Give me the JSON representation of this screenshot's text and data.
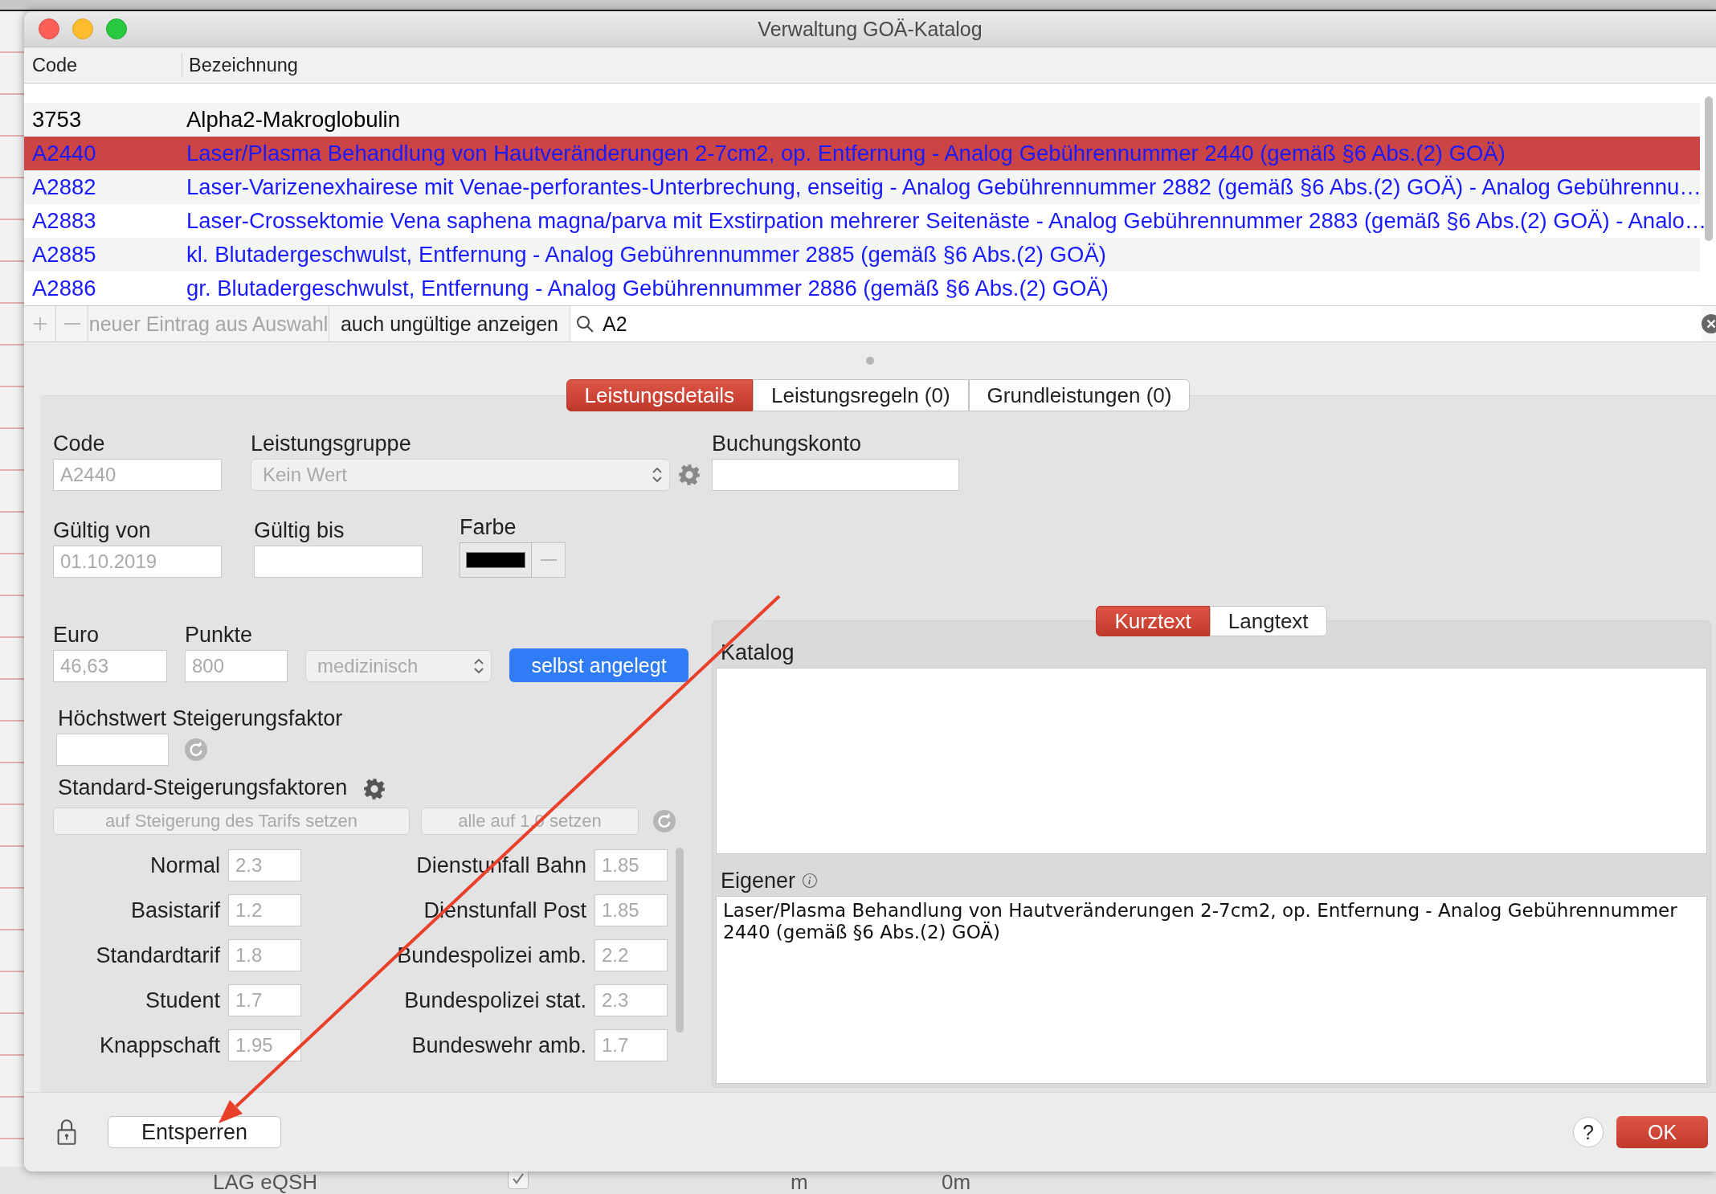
{
  "window": {
    "title": "Verwaltung GOÄ-Katalog"
  },
  "table": {
    "columns": [
      "Code",
      "Bezeichnung"
    ],
    "rows": [
      {
        "code": "3753",
        "name": "Alpha2-Makroglobulin",
        "color": "#000000",
        "selected": false
      },
      {
        "code": "A2440",
        "name": "Laser/Plasma Behandlung von Hautveränderungen 2-7cm2, op. Entfernung - Analog Gebührennummer 2440 (gemäß §6 Abs.(2) GOÄ)",
        "color": "#1a1aff",
        "selected": true
      },
      {
        "code": "A2882",
        "name": "Laser-Varizenexhairese mit Venae-perforantes-Unterbrechung, enseitig - Analog Gebührennummer 2882 (gemäß §6 Abs.(2) GOÄ) - Analog Gebührennu…",
        "color": "#1a1aff",
        "selected": false
      },
      {
        "code": "A2883",
        "name": "Laser-Crossektomie Vena saphena magna/parva mit Exstirpation mehrerer Seitenäste - Analog Gebührennummer 2883 (gemäß §6 Abs.(2) GOÄ) - Analo…",
        "color": "#1a1aff",
        "selected": false
      },
      {
        "code": "A2885",
        "name": "kl. Blutadergeschwulst, Entfernung - Analog Gebührennummer 2885 (gemäß §6 Abs.(2) GOÄ)",
        "color": "#1a1aff",
        "selected": false
      },
      {
        "code": "A2886",
        "name": "gr. Blutadergeschwulst, Entfernung - Analog Gebührennummer 2886 (gemäß §6 Abs.(2) GOÄ)",
        "color": "#1a1aff",
        "selected": false
      }
    ]
  },
  "toolbar": {
    "buttons": [
      {
        "label": "neuer Eintrag aus Auswahl",
        "disabled": true
      },
      {
        "label": "auch ungültige anzeigen",
        "disabled": false
      }
    ],
    "search": {
      "value": "A2"
    }
  },
  "tabs": [
    {
      "label": "Leistungsdetails",
      "selected": true
    },
    {
      "label": "Leistungsregeln (0)",
      "selected": false
    },
    {
      "label": "Grundleistungen (0)",
      "selected": false
    }
  ],
  "details": {
    "code": {
      "label": "Code",
      "value": "A2440",
      "disabled": true
    },
    "group": {
      "label": "Leistungsgruppe",
      "value": "Kein Wert",
      "disabled": true
    },
    "account": {
      "label": "Buchungskonto"
    },
    "valid_from": {
      "label": "Gültig von",
      "value": "01.10.2019",
      "disabled": true
    },
    "valid_to": {
      "label": "Gültig bis"
    },
    "colour": {
      "label": "Farbe",
      "color": "#000000"
    },
    "euro": {
      "label": "Euro",
      "value": "46,63",
      "disabled": true
    },
    "points": {
      "label": "Punkte",
      "value": "800",
      "disabled": true
    },
    "type": {
      "value": "medizinisch",
      "disabled": true
    },
    "self_created": {
      "label": "selbst angelegt",
      "on": true
    },
    "max_factor": {
      "label": "Höchstwert Steigerungsfaktor"
    },
    "std_title": "Standard-Steigerungsfaktoren",
    "std_buttons": [
      "auf Steigerung des Tarifs setzen",
      "alle auf 1.0 setzen"
    ],
    "factors_left": [
      {
        "label": "Normal",
        "value": "2.3"
      },
      {
        "label": "Basistarif",
        "value": "1.2"
      },
      {
        "label": "Standardtarif",
        "value": "1.8"
      },
      {
        "label": "Student",
        "value": "1.7"
      },
      {
        "label": "Knappschaft",
        "value": "1.95"
      }
    ],
    "factors_right": [
      {
        "label": "Dienstunfall Bahn",
        "value": "1.85"
      },
      {
        "label": "Dienstunfall Post",
        "value": "1.85"
      },
      {
        "label": "Bundespolizei amb.",
        "value": "2.2"
      },
      {
        "label": "Bundespolizei stat.",
        "value": "2.3"
      },
      {
        "label": "Bundeswehr amb.",
        "value": "1.7"
      }
    ]
  },
  "text_tabs": [
    {
      "label": "Kurztext",
      "selected": true
    },
    {
      "label": "Langtext",
      "selected": false
    }
  ],
  "catalog": {
    "label": "Katalog"
  },
  "own": {
    "label": "Eigener",
    "text": "Laser/Plasma Behandlung von Hautveränderungen 2-7cm2, op. Entfernung - Analog Gebührennummer 2440 (gemäß §6 Abs.(2) GOÄ)"
  },
  "footer": {
    "unlock": "Entsperren",
    "help": "?",
    "ok": "OK"
  },
  "background": {
    "texts": [
      "LAG eQSH",
      "m",
      "0m"
    ],
    "checked": true
  }
}
